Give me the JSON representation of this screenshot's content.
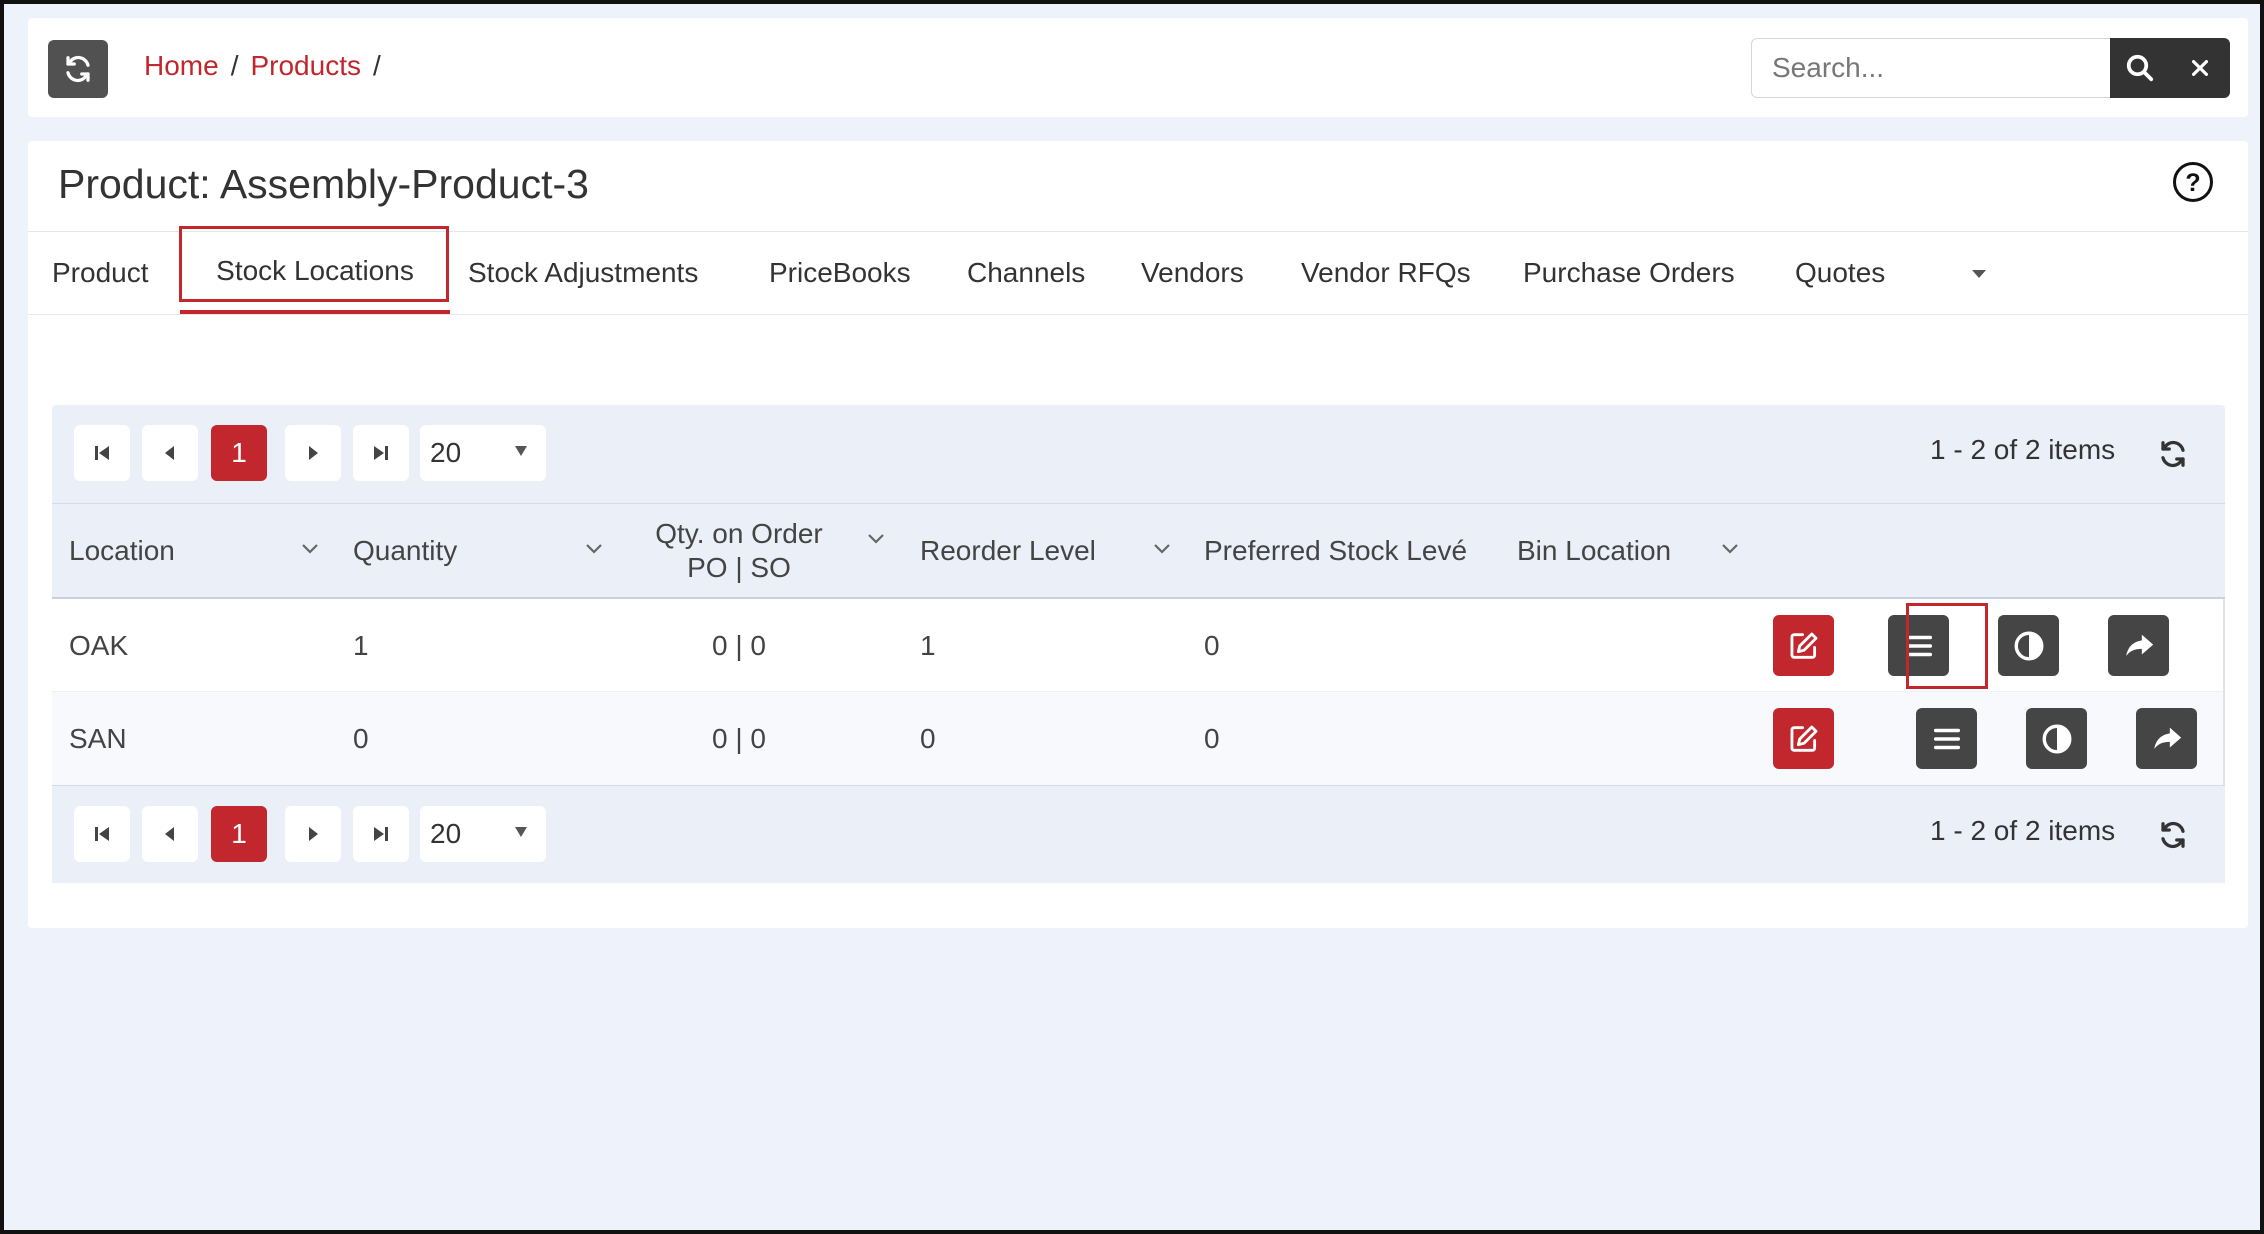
{
  "topbar": {
    "breadcrumb": [
      {
        "label": "Home"
      },
      {
        "label": "Products"
      }
    ],
    "separator": "/",
    "search_placeholder": "Search..."
  },
  "page": {
    "title": "Product: Assembly-Product-3"
  },
  "tabs": [
    {
      "label": "Product",
      "active": false
    },
    {
      "label": "Stock Locations",
      "active": true
    },
    {
      "label": "Stock Adjustments",
      "active": false
    },
    {
      "label": "PriceBooks",
      "active": false
    },
    {
      "label": "Channels",
      "active": false
    },
    {
      "label": "Vendors",
      "active": false
    },
    {
      "label": "Vendor RFQs",
      "active": false
    },
    {
      "label": "Purchase Orders",
      "active": false
    },
    {
      "label": "Quotes",
      "active": false
    }
  ],
  "pager": {
    "current_page": "1",
    "page_size": "20",
    "info": "1 - 2 of 2 items"
  },
  "table": {
    "columns": [
      {
        "label": "Location"
      },
      {
        "label": "Quantity"
      },
      {
        "label_line1": "Qty. on Order",
        "label_line2": "PO | SO"
      },
      {
        "label": "Reorder Level"
      },
      {
        "label": "Preferred Stock Levé"
      },
      {
        "label": "Bin Location"
      }
    ],
    "rows": [
      {
        "location": "OAK",
        "quantity": "1",
        "qty_on_order": "0 | 0",
        "reorder_level": "1",
        "preferred_stock_level": "0",
        "bin_location": ""
      },
      {
        "location": "SAN",
        "quantity": "0",
        "qty_on_order": "0 | 0",
        "reorder_level": "0",
        "preferred_stock_level": "0",
        "bin_location": ""
      }
    ]
  },
  "colors": {
    "accent": "#c1272d",
    "dark_button": "#454545",
    "grid_header_bg": "#eaeff8"
  },
  "icons": [
    "refresh-icon",
    "search-icon",
    "close-icon",
    "help-icon",
    "chevron-down-icon",
    "first-page-icon",
    "prev-page-icon",
    "next-page-icon",
    "last-page-icon",
    "edit-icon",
    "menu-icon",
    "contrast-icon",
    "share-icon"
  ]
}
